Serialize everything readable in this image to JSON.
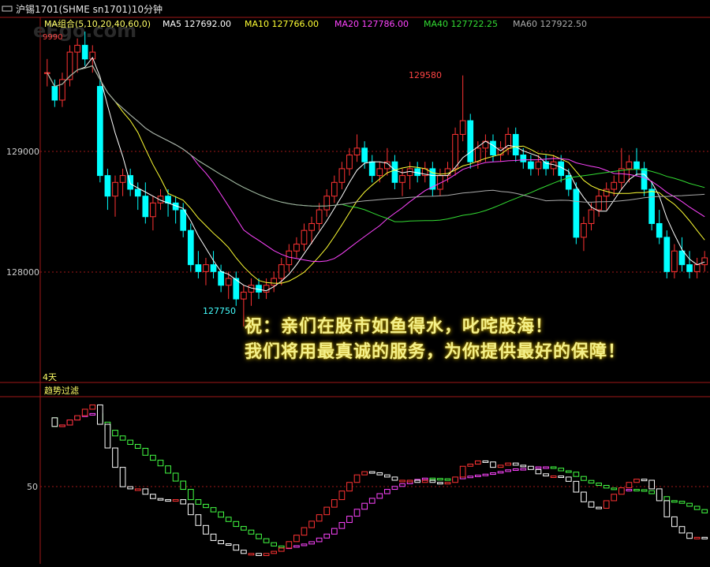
{
  "header": {
    "instrument_label": "沪锡1701(SHME sn1701)10分钟",
    "watermark": "eEgo.com",
    "ma_group_label": "MA组合(5,10,20,40,60,0)",
    "ma": [
      {
        "label": "MA5 127692.00",
        "color": "#ffffff"
      },
      {
        "label": "MA10 127766.00",
        "color": "#ffff33"
      },
      {
        "label": "MA20 127786.00",
        "color": "#ff44ff"
      },
      {
        "label": "MA40 127722.25",
        "color": "#33dd33"
      },
      {
        "label": "MA60 127922.50",
        "color": "#aaaaaa"
      }
    ],
    "truncated_top_value": "9990"
  },
  "price_axis": {
    "ticks": [
      "129000",
      "128000"
    ]
  },
  "annotations": {
    "high": "129580",
    "low": "127750"
  },
  "price_panel": {
    "period_label": "4天"
  },
  "indicator_panel": {
    "title": "趋势过滤",
    "tick": "50"
  },
  "message": {
    "line1": "祝：亲们在股市如鱼得水，叱咤股海！",
    "line2": "我们将用最真诚的服务，为你提供最好的保障！"
  },
  "colors": {
    "up": "#ff3333",
    "down": "#00ffff",
    "grid": "#a01818",
    "panel_border": "#a01818"
  },
  "chart_data": {
    "type": "candlestick",
    "ylim": [
      127600,
      129900
    ],
    "candles": [
      [
        129600,
        129700,
        129500,
        129600
      ],
      [
        129500,
        129550,
        129350,
        129400
      ],
      [
        129400,
        129600,
        129350,
        129550
      ],
      [
        129550,
        129800,
        129500,
        129750
      ],
      [
        129750,
        129850,
        129600,
        129800
      ],
      [
        129800,
        129900,
        129650,
        129700
      ],
      [
        129700,
        129800,
        129600,
        129750
      ],
      [
        129500,
        129550,
        128800,
        128850
      ],
      [
        128850,
        128900,
        128600,
        128700
      ],
      [
        128700,
        128850,
        128550,
        128800
      ],
      [
        128800,
        128900,
        128700,
        128850
      ],
      [
        128850,
        128900,
        128700,
        128750
      ],
      [
        128750,
        128800,
        128600,
        128700
      ],
      [
        128700,
        128800,
        128500,
        128550
      ],
      [
        128550,
        128700,
        128450,
        128650
      ],
      [
        128650,
        128750,
        128600,
        128700
      ],
      [
        128700,
        128750,
        128550,
        128650
      ],
      [
        128650,
        128700,
        128500,
        128600
      ],
      [
        128600,
        128650,
        128400,
        128450
      ],
      [
        128450,
        128500,
        128150,
        128200
      ],
      [
        128200,
        128300,
        128100,
        128150
      ],
      [
        128150,
        128250,
        128050,
        128200
      ],
      [
        128200,
        128300,
        128100,
        128150
      ],
      [
        128150,
        128200,
        128000,
        128050
      ],
      [
        128050,
        128150,
        127950,
        128100
      ],
      [
        128100,
        128150,
        127900,
        127950
      ],
      [
        127950,
        128050,
        127750,
        128000
      ],
      [
        128000,
        128100,
        127900,
        128050
      ],
      [
        128050,
        128100,
        127950,
        128000
      ],
      [
        128000,
        128100,
        127950,
        128050
      ],
      [
        128050,
        128150,
        128000,
        128100
      ],
      [
        128100,
        128250,
        128050,
        128200
      ],
      [
        128200,
        128350,
        128150,
        128300
      ],
      [
        128300,
        128400,
        128250,
        128350
      ],
      [
        128350,
        128500,
        128300,
        128450
      ],
      [
        128450,
        128550,
        128350,
        128500
      ],
      [
        128500,
        128650,
        128450,
        128600
      ],
      [
        128600,
        128750,
        128550,
        128700
      ],
      [
        128700,
        128850,
        128650,
        128800
      ],
      [
        128800,
        128950,
        128750,
        128900
      ],
      [
        128900,
        129050,
        128850,
        129000
      ],
      [
        129000,
        129150,
        128950,
        129050
      ],
      [
        129050,
        129100,
        128900,
        128950
      ],
      [
        128950,
        129000,
        128800,
        128850
      ],
      [
        128850,
        128950,
        128800,
        128900
      ],
      [
        128900,
        129050,
        128850,
        128950
      ],
      [
        128950,
        129000,
        128750,
        128800
      ],
      [
        128800,
        128900,
        128700,
        128850
      ],
      [
        128850,
        128950,
        128750,
        128900
      ],
      [
        128900,
        128950,
        128800,
        128850
      ],
      [
        128850,
        128950,
        128800,
        128900
      ],
      [
        128900,
        128950,
        128700,
        128750
      ],
      [
        128750,
        128900,
        128700,
        128850
      ],
      [
        128850,
        128950,
        128800,
        128900
      ],
      [
        128900,
        129200,
        128850,
        129150
      ],
      [
        129150,
        129580,
        129100,
        129250
      ],
      [
        129250,
        129300,
        128900,
        128950
      ],
      [
        128950,
        129100,
        128900,
        129050
      ],
      [
        129050,
        129150,
        128950,
        129100
      ],
      [
        129100,
        129150,
        128950,
        129000
      ],
      [
        129000,
        129100,
        128950,
        129050
      ],
      [
        129050,
        129200,
        129000,
        129150
      ],
      [
        129150,
        129200,
        128950,
        129000
      ],
      [
        129000,
        129050,
        128900,
        128950
      ],
      [
        128950,
        129000,
        128850,
        128900
      ],
      [
        128900,
        129000,
        128850,
        128950
      ],
      [
        128950,
        129000,
        128850,
        128900
      ],
      [
        128900,
        129000,
        128850,
        128950
      ],
      [
        128950,
        129000,
        128800,
        128850
      ],
      [
        128850,
        128900,
        128700,
        128750
      ],
      [
        128750,
        128800,
        128350,
        128400
      ],
      [
        128400,
        128550,
        128300,
        128500
      ],
      [
        128500,
        128650,
        128450,
        128600
      ],
      [
        128600,
        128750,
        128550,
        128700
      ],
      [
        128700,
        128800,
        128600,
        128750
      ],
      [
        128750,
        128850,
        128700,
        128800
      ],
      [
        128800,
        129050,
        128750,
        128900
      ],
      [
        128900,
        129000,
        128800,
        128950
      ],
      [
        128950,
        129050,
        128850,
        128900
      ],
      [
        128900,
        128950,
        128700,
        128750
      ],
      [
        128750,
        128800,
        128450,
        128500
      ],
      [
        128500,
        128600,
        128350,
        128400
      ],
      [
        128400,
        128450,
        128100,
        128150
      ],
      [
        128150,
        128350,
        128100,
        128300
      ],
      [
        128300,
        128400,
        128150,
        128200
      ],
      [
        128200,
        128300,
        128100,
        128150
      ],
      [
        128150,
        128250,
        128100,
        128200
      ],
      [
        128200,
        128300,
        128150,
        128250
      ]
    ]
  }
}
